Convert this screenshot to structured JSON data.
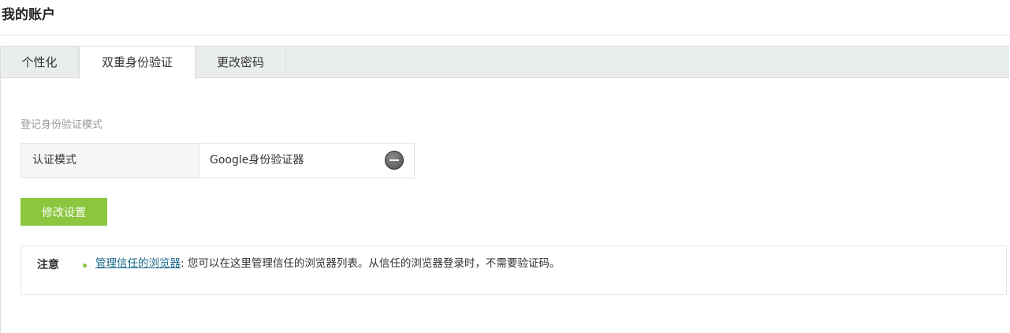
{
  "page": {
    "title": "我的账户"
  },
  "tabs": [
    {
      "label": "个性化",
      "active": false
    },
    {
      "label": "双重身份验证",
      "active": true
    },
    {
      "label": "更改密码",
      "active": false
    }
  ],
  "auth": {
    "section_label": "登记身份验证模式",
    "key_label": "认证模式",
    "value": "Google身份验证器",
    "icon": "google-authenticator-icon"
  },
  "buttons": {
    "modify_label": "修改设置"
  },
  "note": {
    "title": "注意",
    "link_text": "管理信任的浏览器",
    "text": ": 您可以在这里管理信任的浏览器列表。从信任的浏览器登录时，不需要验证码。"
  },
  "colors": {
    "accent": "#8cc63f",
    "link": "#1a6a8a",
    "tabbar_bg": "#eaedee"
  }
}
